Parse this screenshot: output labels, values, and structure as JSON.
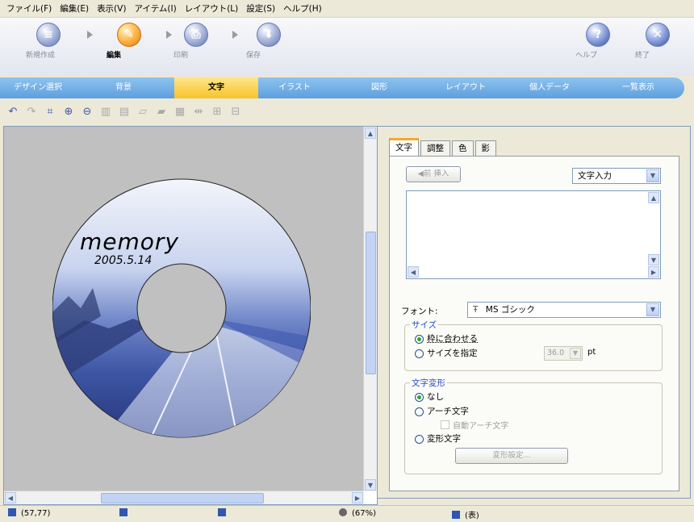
{
  "menu": [
    "ファイル(F)",
    "編集(E)",
    "表示(V)",
    "アイテム(I)",
    "レイアウト(L)",
    "設定(S)",
    "ヘルプ(H)"
  ],
  "steps": [
    {
      "label": "新規作成",
      "icon": "new-document-icon",
      "active": false
    },
    {
      "label": "編集",
      "icon": "edit-icon",
      "active": true
    },
    {
      "label": "印刷",
      "icon": "print-icon",
      "active": false
    },
    {
      "label": "保存",
      "icon": "save-icon",
      "active": false
    }
  ],
  "help_label": "ヘルプ",
  "exit_label": "終了",
  "categories": [
    {
      "label": "デザイン選択",
      "active": false
    },
    {
      "label": "背景",
      "active": false
    },
    {
      "label": "文字",
      "active": true
    },
    {
      "label": "イラスト",
      "active": false
    },
    {
      "label": "図形",
      "active": false
    },
    {
      "label": "レイアウト",
      "active": false
    },
    {
      "label": "個人データ",
      "active": false
    },
    {
      "label": "一覧表示",
      "active": false
    }
  ],
  "tools": [
    "undo-icon",
    "redo-icon",
    "select-icon",
    "zoom-in-icon",
    "zoom-out-icon",
    "delete-icon",
    "copy-icon",
    "paste-icon",
    "bring-front-icon",
    "send-back-icon",
    "align-icon",
    "group-icon",
    "ungroup-icon"
  ],
  "canvas": {
    "title_text": "memory",
    "date_text": "2005.5.14"
  },
  "panel": {
    "tabs": [
      {
        "label": "文字",
        "active": true
      },
      {
        "label": "調整",
        "active": false
      },
      {
        "label": "色",
        "active": false
      },
      {
        "label": "影",
        "active": false
      }
    ],
    "insert_button": "◀前 挿入",
    "input_mode": "文字入力",
    "font_label": "フォント:",
    "font_value": "MS ゴシック",
    "font_icon": "Ŧ",
    "size_group": "サイズ",
    "size_fit": "枠に合わせる",
    "size_specify": "サイズを指定",
    "size_value": "36.0",
    "size_unit": "pt",
    "transform_group": "文字変形",
    "transform_none": "なし",
    "transform_arch": "アーチ文字",
    "transform_auto_arch": "自動アーチ文字",
    "transform_shape": "変形文字",
    "transform_settings": "変形設定..."
  },
  "status": {
    "pos": "(57,77)",
    "zoom": "(67%)",
    "side": "(表)"
  }
}
